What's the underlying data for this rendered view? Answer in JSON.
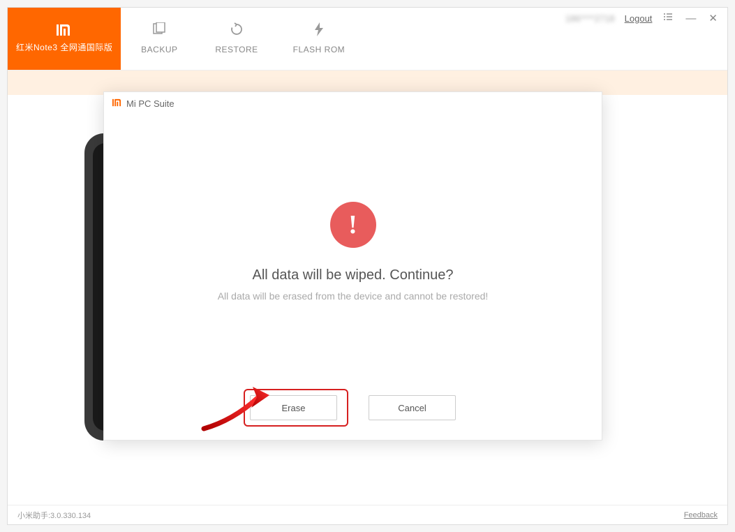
{
  "toolbar": {
    "device_label": "红米Note3 全网通国际版",
    "backup_label": "BACKUP",
    "restore_label": "RESTORE",
    "flash_label": "FLASH ROM"
  },
  "window_controls": {
    "username_obscured": "186****2718",
    "logout_label": "Logout"
  },
  "dialog": {
    "app_title": "Mi PC Suite",
    "warning_glyph": "!",
    "title": "All data will be wiped. Continue?",
    "subtitle": "All data will be erased from the device and cannot be restored!",
    "erase_btn": "Erase",
    "cancel_btn": "Cancel"
  },
  "status": {
    "version_text": "小米助手:3.0.330.134",
    "feedback_label": "Feedback"
  },
  "phone": {
    "brand": "mi"
  }
}
